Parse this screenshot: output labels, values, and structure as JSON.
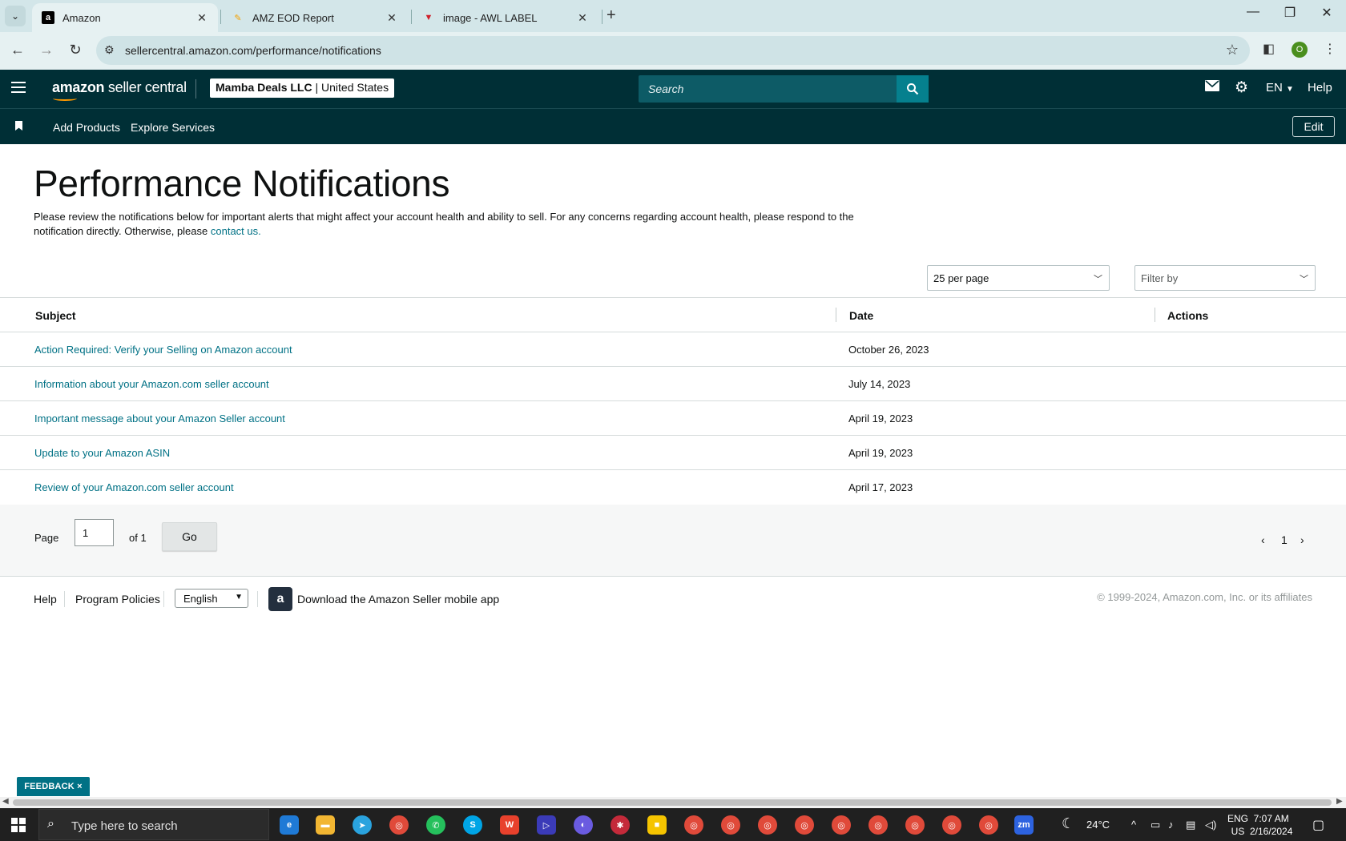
{
  "browser": {
    "tabs": [
      {
        "title": "Amazon",
        "favicon": "amazon-icon"
      },
      {
        "title": "AMZ EOD Report",
        "favicon": "sheets-icon"
      },
      {
        "title": "image - AWL LABEL",
        "favicon": "label-icon"
      }
    ],
    "url": "sellercentral.amazon.com/performance/notifications",
    "profile_initial": "O"
  },
  "header": {
    "logo_amazon": "amazon",
    "logo_seller": "seller central",
    "account_name": "Mamba Deals LLC",
    "account_region": "United States",
    "search_placeholder": "Search",
    "language": "EN",
    "help": "Help"
  },
  "subnav": {
    "links": [
      "Add Products",
      "Explore Services"
    ],
    "edit": "Edit"
  },
  "page": {
    "title": "Performance Notifications",
    "description": "Please review the notifications below for important alerts that might affect your account health and ability to sell. For any concerns regarding account health, please respond to the notification directly. Otherwise, please ",
    "contact_link": "contact us.",
    "per_page": "25 per page",
    "filter_placeholder": "Filter by"
  },
  "table": {
    "headers": {
      "subject": "Subject",
      "date": "Date",
      "actions": "Actions"
    },
    "rows": [
      {
        "subject": "Action Required: Verify your Selling on Amazon account",
        "date": "October 26, 2023"
      },
      {
        "subject": "Information about your Amazon.com seller account",
        "date": "July 14, 2023"
      },
      {
        "subject": "Important message about your Amazon Seller account",
        "date": "April 19, 2023"
      },
      {
        "subject": "Update to your Amazon ASIN",
        "date": "April 19, 2023"
      },
      {
        "subject": "Review of your Amazon.com seller account",
        "date": "April 17, 2023"
      }
    ]
  },
  "pagination": {
    "page_label": "Page",
    "page_value": "1",
    "of_label": "of 1",
    "go": "Go",
    "current": "1"
  },
  "footer": {
    "help": "Help",
    "program_policies": "Program Policies",
    "language": "English",
    "mobile_app": "Download the Amazon Seller mobile app",
    "copyright": "© 1999-2024, Amazon.com, Inc. or its affiliates"
  },
  "feedback": "FEEDBACK ×",
  "taskbar": {
    "search_placeholder": "Type here to search",
    "weather": "24°C",
    "lang_top": "ENG",
    "lang_bottom": "US",
    "time": "7:07 AM",
    "date": "2/16/2024"
  },
  "colors": {
    "header_bg": "#002f36",
    "link": "#007185",
    "search_btn": "#05808e"
  }
}
